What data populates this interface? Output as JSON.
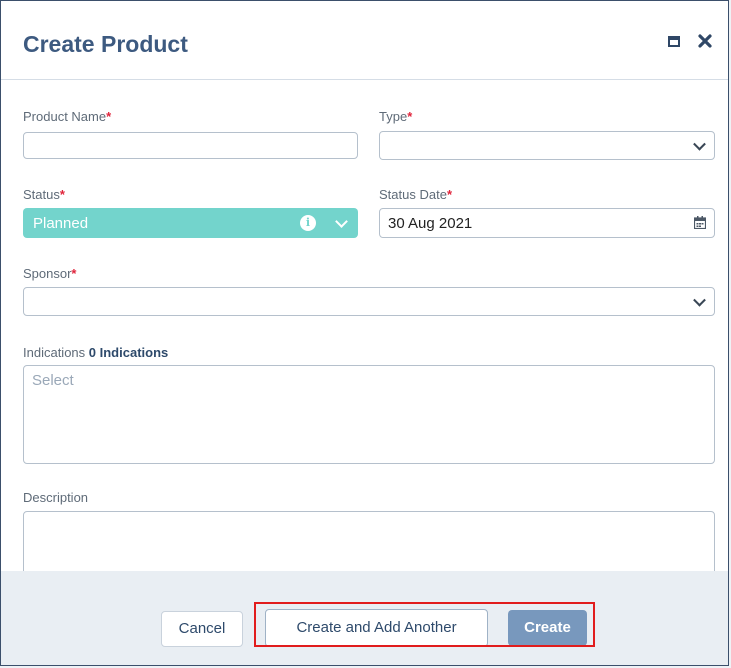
{
  "dialog": {
    "title": "Create Product"
  },
  "form": {
    "product_name": {
      "label": "Product Name",
      "required_mark": "*",
      "value": ""
    },
    "type": {
      "label": "Type",
      "required_mark": "*",
      "value": ""
    },
    "status": {
      "label": "Status",
      "required_mark": "*",
      "value": "Planned"
    },
    "status_date": {
      "label": "Status Date",
      "required_mark": "*",
      "value": "30 Aug 2021"
    },
    "sponsor": {
      "label": "Sponsor",
      "required_mark": "*",
      "value": ""
    },
    "indications": {
      "label": "Indications",
      "count_label": "0 Indications",
      "placeholder": "Select"
    },
    "description": {
      "label": "Description",
      "value": ""
    }
  },
  "buttons": {
    "cancel": "Cancel",
    "create_and_add_another": "Create and Add Another",
    "create": "Create"
  },
  "icons": {
    "maximize": "maximize-icon",
    "close": "close-icon",
    "info": "info-icon",
    "calendar": "calendar-icon",
    "chevron": "chevron-down-icon"
  },
  "colors": {
    "status_fill": "#73d4cc",
    "title": "#3d5a80",
    "required": "#e0243b",
    "primary_button": "#7898bd",
    "highlight": "#e11c1c"
  }
}
